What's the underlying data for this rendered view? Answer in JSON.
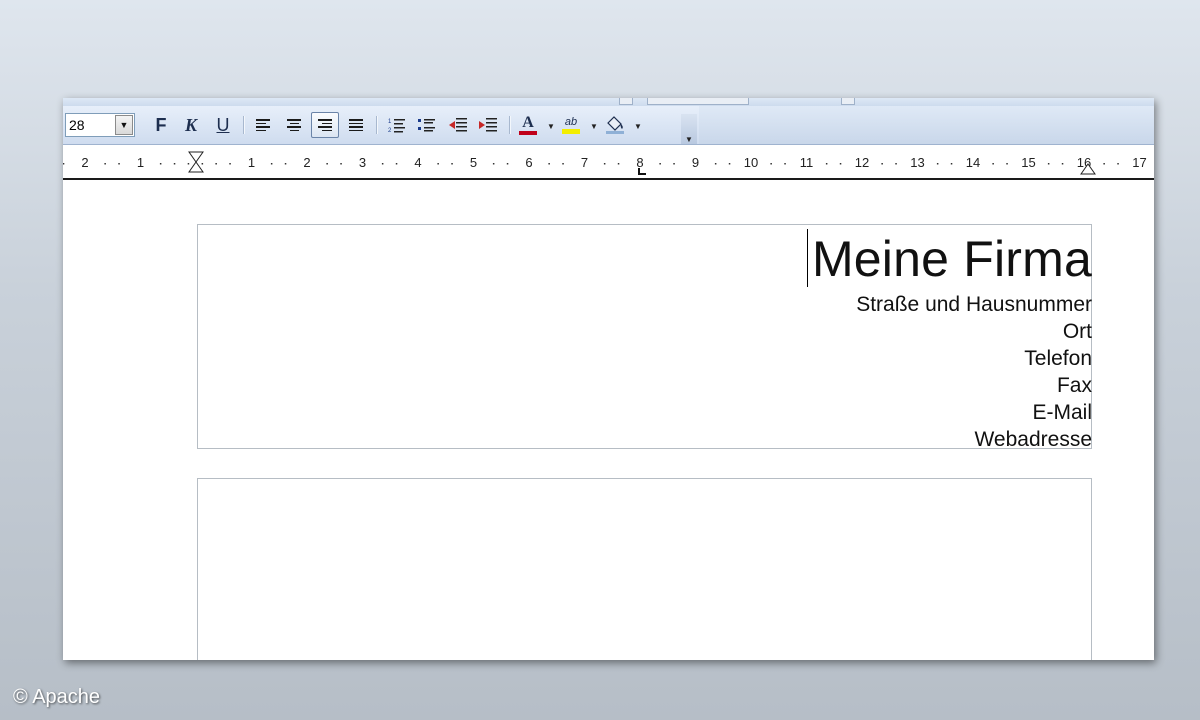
{
  "toolbar": {
    "font_size": "28",
    "bold_label": "F",
    "italic_label": "K",
    "underline_label": "U",
    "font_color_label": "A",
    "highlight_label": "ab",
    "font_color": "#c0001a",
    "highlight_color": "#f3ee00"
  },
  "ruler": {
    "labels": [
      "2",
      "1",
      "1",
      "2",
      "3",
      "4",
      "5",
      "6",
      "7",
      "8",
      "9",
      "10",
      "11",
      "12",
      "13",
      "14",
      "15",
      "16",
      "17"
    ]
  },
  "document": {
    "company": "Meine Firma",
    "lines": [
      "Straße und Hausnummer",
      "Ort",
      "Telefon",
      "Fax",
      "E-Mail",
      "Webadresse"
    ]
  },
  "copyright": "© Apache"
}
